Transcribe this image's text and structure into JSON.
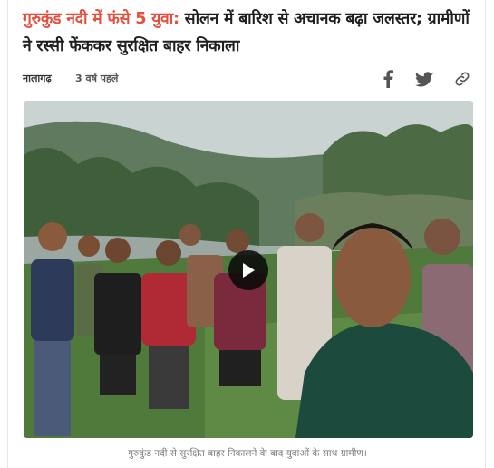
{
  "article": {
    "headline_highlight": "गुरुकुंड नदी में फंसे 5 युवा:",
    "headline_rest": " सोलन में बारिश से अचानक बढ़ा जलस्तर; ग्रामीणों ने रस्सी फेंककर सुरक्षित बाहर निकाला",
    "location": "नालागढ़",
    "time_ago": "3 वर्ष पहले",
    "caption": "गुरुकुंड नदी से सुरक्षित बाहर निकालने के बाद युवाओं के साथ ग्रामीण।"
  },
  "share": {
    "icons": [
      "facebook-icon",
      "twitter-icon",
      "link-icon"
    ]
  },
  "colors": {
    "highlight": "#e3503e",
    "icon": "#555555"
  }
}
